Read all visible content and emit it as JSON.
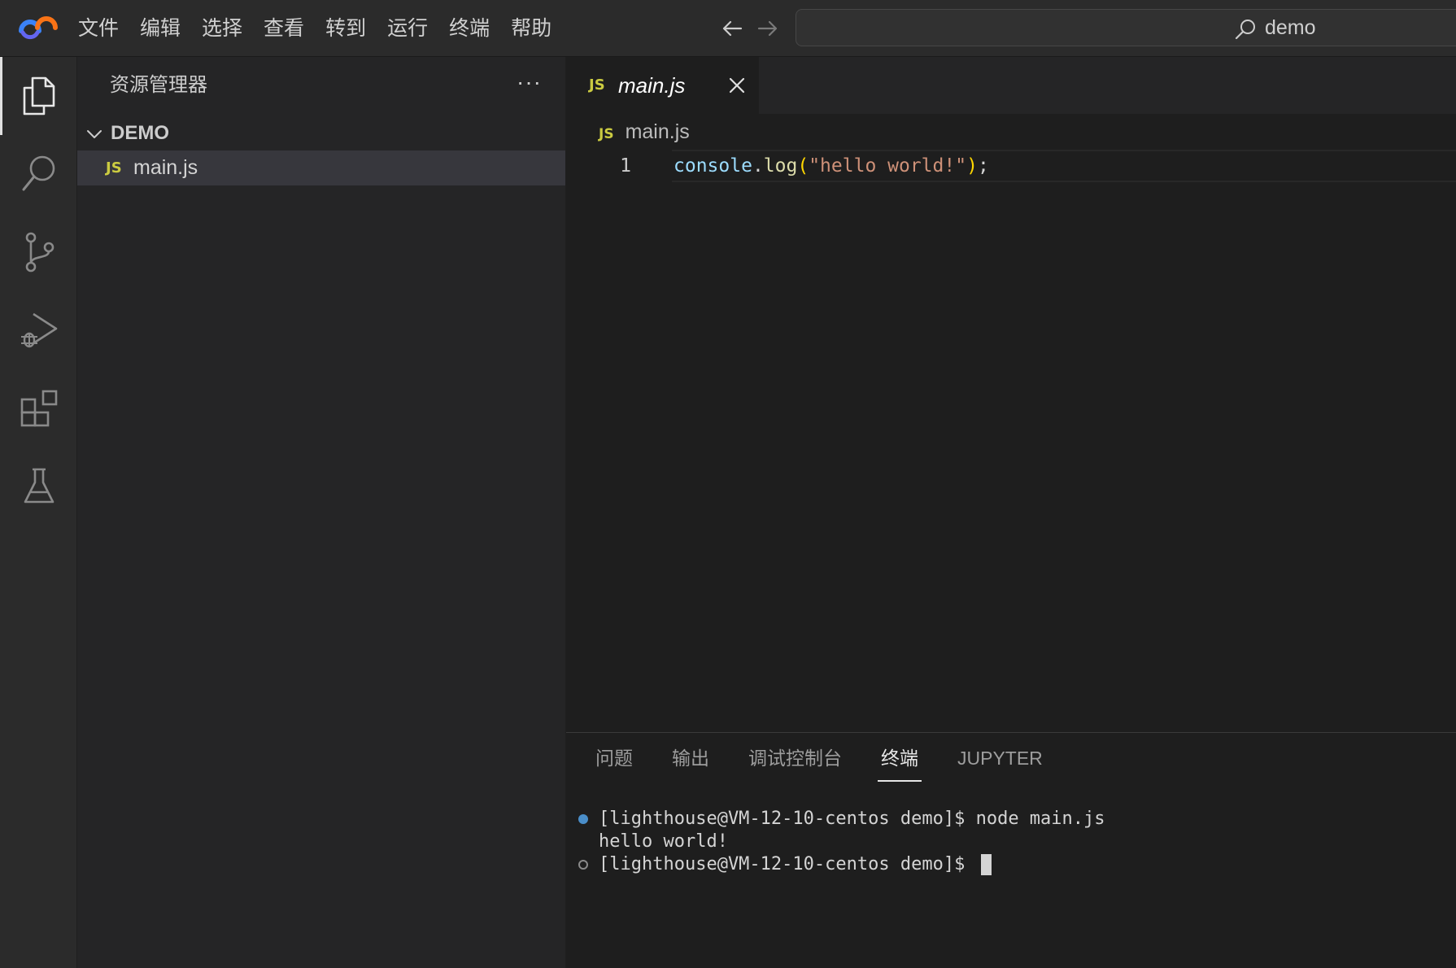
{
  "menu": [
    "文件",
    "编辑",
    "选择",
    "查看",
    "转到",
    "运行",
    "终端",
    "帮助"
  ],
  "search": {
    "text": "demo"
  },
  "sidebar": {
    "title": "资源管理器",
    "more": "···",
    "folder": "DEMO",
    "files": [
      {
        "badge": "JS",
        "name": "main.js"
      }
    ]
  },
  "editor": {
    "tab": {
      "badge": "JS",
      "name": "main.js"
    },
    "breadcrumb": {
      "badge": "JS",
      "name": "main.js"
    },
    "line_number": "1",
    "code": {
      "obj": "console",
      "dot": ".",
      "fn": "log",
      "open": "(",
      "str": "\"hello world!\"",
      "close": ")",
      "semi": ";"
    }
  },
  "panel": {
    "tabs": [
      "问题",
      "输出",
      "调试控制台",
      "终端",
      "JUPYTER"
    ],
    "active_tab": "终端",
    "terminal": [
      "[lighthouse@VM-12-10-centos demo]$ node main.js",
      "hello world!",
      "[lighthouse@VM-12-10-centos demo]$ "
    ]
  },
  "colors": {
    "accent": "#e0e0e0",
    "js_badge": "#cbcb41",
    "string": "#ce9178",
    "keyword_obj": "#9cdcfe",
    "function": "#dcdcaa"
  }
}
